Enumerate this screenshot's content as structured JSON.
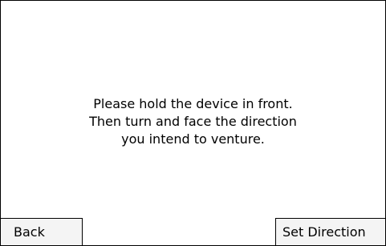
{
  "message": {
    "lines": [
      "Please hold the device in front.",
      "Then turn and face the direction",
      "you intend to venture."
    ]
  },
  "buttons": {
    "back_label": "Back",
    "set_direction_label": "Set Direction"
  },
  "colors": {
    "background": "#ffffff",
    "border": "#000000",
    "button_background": "#f4f4f4",
    "text": "#000000"
  }
}
